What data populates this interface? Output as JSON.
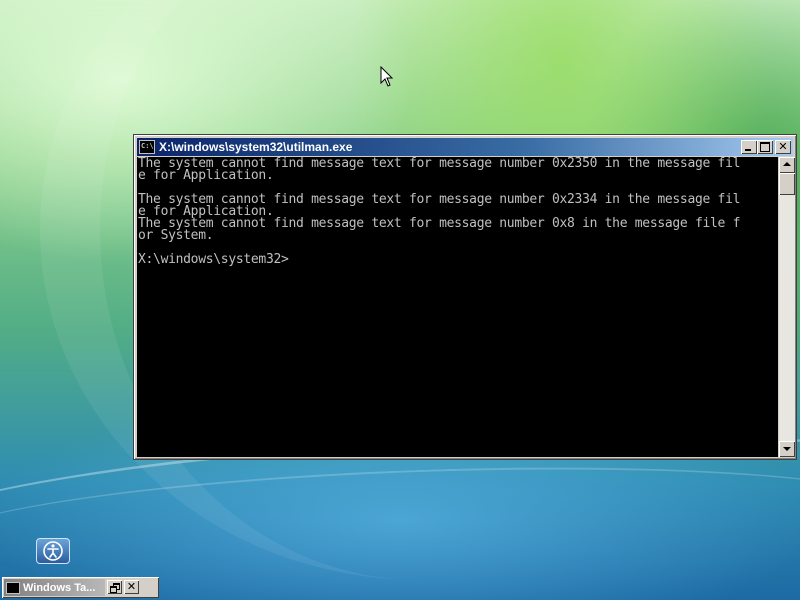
{
  "desktop": {
    "cursor_icon": "arrow-cursor-icon",
    "ease_of_access_icon": "ease-of-access-icon"
  },
  "console": {
    "title": "X:\\windows\\system32\\utilman.exe",
    "icon": "command-prompt-icon",
    "icon_text": "C:\\.",
    "buttons": {
      "minimize": "minimize-icon",
      "maximize": "maximize-icon",
      "close": "close-icon",
      "close_label": "✕"
    },
    "output_lines": [
      "The system cannot find message text for message number 0x2350 in the message fil",
      "e for Application.",
      "",
      "The system cannot find message text for message number 0x2334 in the message fil",
      "e for Application.",
      "The system cannot find message text for message number 0x8 in the message file f",
      "or System.",
      "",
      "X:\\windows\\system32>"
    ]
  },
  "taskbar_window": {
    "title": "Windows Ta...",
    "restore": "restore-icon",
    "close_label": "✕"
  },
  "colors": {
    "console_text": "#c0c0c0",
    "console_bg": "#000000",
    "titlebar_active": "#0a246a",
    "window_face": "#d4d0c8"
  }
}
